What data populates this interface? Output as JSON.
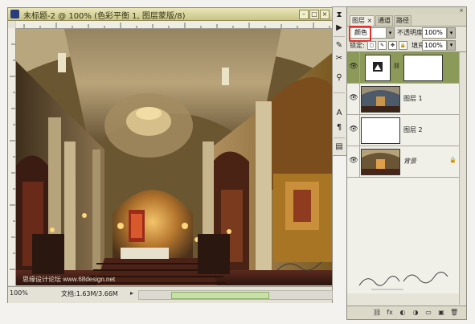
{
  "document": {
    "title": "未标题-2 @ 100% (色彩平衡 1, 图层蒙版/8)",
    "zoom": "100%",
    "doc_size": "文档:1.63M/3.66M",
    "minimize_glyph": "–",
    "restore_glyph": "□",
    "close_glyph": "×",
    "status_arrow": "▸"
  },
  "canvas": {
    "watermark": "思缘设计论坛 www.68design.net"
  },
  "toolstrip": {
    "tools": [
      {
        "name": "history-icon",
        "glyph": "⧗"
      },
      {
        "name": "actions-icon",
        "glyph": "▶"
      },
      {
        "name": "brushes-icon",
        "glyph": "✎"
      },
      {
        "name": "tool-presets-icon",
        "glyph": "✂"
      },
      {
        "name": "clone-source-icon",
        "glyph": "⚲"
      },
      {
        "name": "character-icon",
        "glyph": "A"
      },
      {
        "name": "paragraph-icon",
        "glyph": "¶"
      },
      {
        "name": "layer-comps-icon",
        "glyph": "▤"
      }
    ]
  },
  "panel": {
    "close_glyph": "×",
    "tabs": [
      "图层",
      "通道",
      "路径"
    ],
    "tab_close": "×",
    "blend_mode": "颜色",
    "dropdown_glyph": "▾",
    "opacity_label": "不透明度:",
    "opacity_value": "100%",
    "lock_label": "锁定:",
    "lock_icons": [
      "▢",
      "✎",
      "✥",
      "🔒"
    ],
    "fill_label": "填充:",
    "fill_value": "100%",
    "layers": [
      {
        "name": "",
        "type": "adjustment",
        "visible": true,
        "selected": true
      },
      {
        "name": "图层 1",
        "type": "image",
        "visible": true,
        "selected": false
      },
      {
        "name": "图层 2",
        "type": "white",
        "visible": true,
        "selected": false
      },
      {
        "name": "背景",
        "type": "image",
        "visible": true,
        "selected": false,
        "locked": true
      }
    ],
    "eye_glyph": "👁",
    "chain_glyph": "⛓",
    "lock_glyph": "🔒",
    "bottom_buttons": [
      "⛓",
      "fx",
      "◐",
      "◑",
      "▭",
      "▣",
      "🗑"
    ]
  },
  "colors": {
    "title_bar": "#d5d19b",
    "selected_layer": "#8b9a58",
    "highlight_box": "#e2302a"
  }
}
